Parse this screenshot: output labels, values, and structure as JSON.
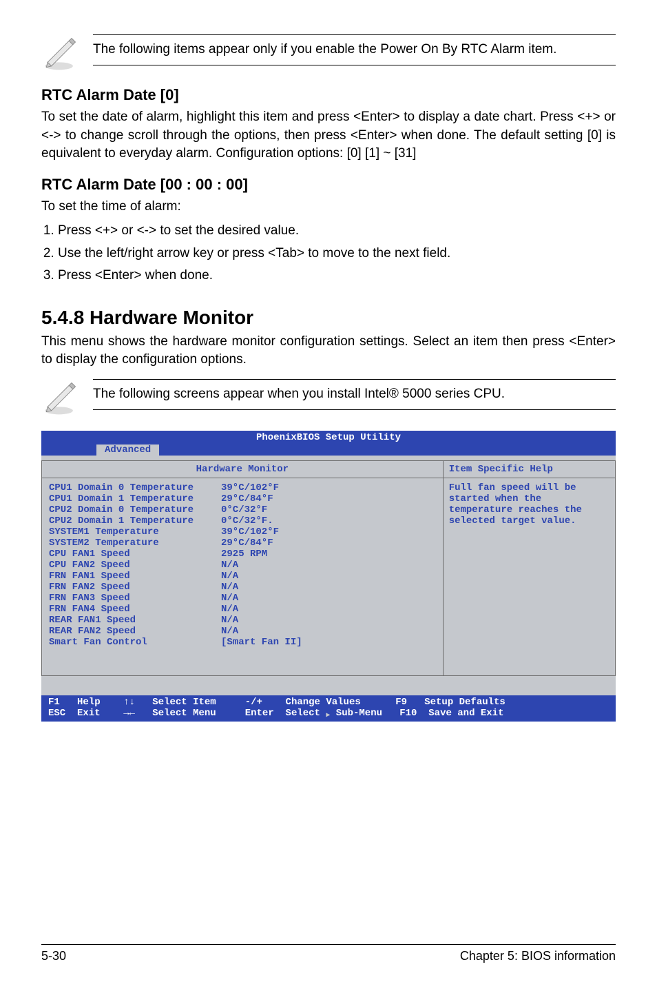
{
  "note1": "The following items appear only if you enable the Power On By RTC Alarm item.",
  "rtc_date": {
    "heading": "RTC Alarm Date [0]",
    "body": "To set the date of alarm, highlight this item and press <Enter> to display a date chart. Press <+> or <-> to change scroll through the options, then press <Enter> when done. The default setting [0] is equivalent to everyday alarm. Configuration options: [0] [1] ~ [31]"
  },
  "rtc_time": {
    "heading": "RTC Alarm Date [00 : 00 : 00]",
    "intro": "To set the time of alarm:",
    "steps": [
      "Press <+> or <-> to set the desired value.",
      "Use the left/right arrow key or press <Tab> to move to the next field.",
      "Press <Enter> when done."
    ]
  },
  "hw_monitor": {
    "heading": "5.4.8 Hardware Monitor",
    "body": "This menu shows the hardware monitor configuration settings.  Select an item then press <Enter> to display the configuration options."
  },
  "note2": "The following screens appear when you install Intel® 5000 series CPU.",
  "bios": {
    "title": "PhoenixBIOS Setup Utility",
    "tab": "Advanced",
    "panel_title": "Hardware Monitor",
    "help_title": "Item Specific Help",
    "help_text": "Full fan speed will be started when the temperature reaches the selected target value.",
    "rows": [
      {
        "label": "CPU1 Domain 0 Temperature",
        "value": "39°C/102°F"
      },
      {
        "label": "CPU1 Domain 1 Temperature",
        "value": "29°C/84°F"
      },
      {
        "label": "CPU2 Domain 0 Temperature",
        "value": "0°C/32°F"
      },
      {
        "label": "CPU2 Domain 1 Temperature",
        "value": "0°C/32°F."
      },
      {
        "label": "SYSTEM1 Temperature",
        "value": "39°C/102°F"
      },
      {
        "label": "SYSTEM2 Temperature",
        "value": "29°C/84°F"
      },
      {
        "label": "CPU FAN1 Speed",
        "value": "2925 RPM"
      },
      {
        "label": "CPU FAN2 Speed",
        "value": "N/A"
      },
      {
        "label": "FRN FAN1 Speed",
        "value": "N/A"
      },
      {
        "label": "FRN FAN2 Speed",
        "value": "N/A"
      },
      {
        "label": "FRN FAN3 Speed",
        "value": "N/A"
      },
      {
        "label": "FRN FAN4 Speed",
        "value": "N/A"
      },
      {
        "label": "REAR FAN1 Speed",
        "value": "N/A"
      },
      {
        "label": "REAR FAN2 Speed",
        "value": "N/A"
      },
      {
        "label": "Smart Fan Control",
        "value": "[Smart Fan II]"
      }
    ],
    "footer": {
      "f1": "F1",
      "help": "Help",
      "updown": "↑↓",
      "select_item": "Select Item",
      "pm": "-/+",
      "change_values": "Change Values",
      "f9": "F9",
      "setup_defaults": "Setup Defaults",
      "esc": "ESC",
      "exit": "Exit",
      "lr": "→←",
      "select_menu": "Select Menu",
      "enter": "Enter",
      "select_sub": "Select ▸ Sub-Menu",
      "f10": "F10",
      "save_exit": "Save and Exit"
    }
  },
  "page_footer": {
    "left": "5-30",
    "right": "Chapter 5: BIOS information"
  }
}
